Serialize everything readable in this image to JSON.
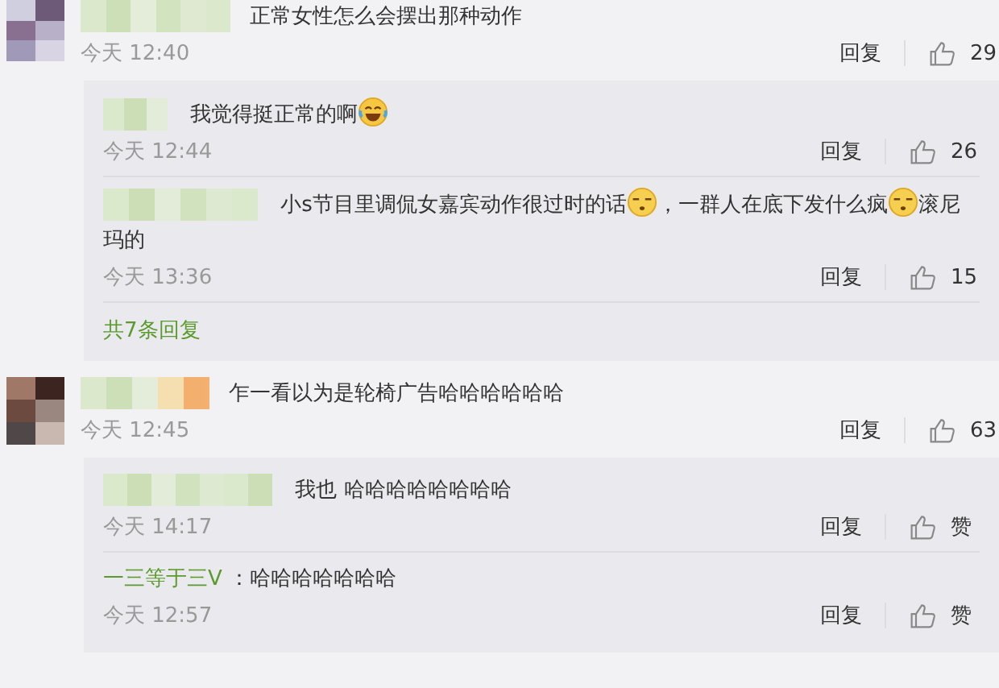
{
  "comments": [
    {
      "avatar": {
        "kind": "mosaic"
      },
      "segments": [
        {
          "kind": "text",
          "text": "正常女性怎么会摆出那种动作"
        }
      ],
      "time": "今天 12:40",
      "reply_label": "回复",
      "likes": "29",
      "replies": [
        {
          "segments": [
            {
              "kind": "text",
              "text": "我觉得挺正常的啊"
            },
            {
              "kind": "laugh"
            }
          ],
          "time": "今天 12:44",
          "reply_label": "回复",
          "likes": "26"
        },
        {
          "segments": [
            {
              "kind": "text",
              "text": "小s节目里调侃女嘉宾动作很过时的话"
            },
            {
              "kind": "squint"
            },
            {
              "kind": "text",
              "text": "，一群人在底下发什么疯"
            },
            {
              "kind": "squint"
            },
            {
              "kind": "text",
              "text": "滚尼"
            },
            {
              "kind": "text",
              "text": "玛的"
            }
          ],
          "time": "今天 13:36",
          "reply_label": "回复",
          "likes": "15"
        }
      ],
      "more_replies": "共7条回复"
    },
    {
      "avatar": {
        "kind": "mosaic"
      },
      "segments": [
        {
          "kind": "text",
          "text": "乍一看以为是轮椅广告哈哈哈哈哈哈"
        }
      ],
      "time": "今天 12:45",
      "reply_label": "回复",
      "likes": "63",
      "replies": [
        {
          "segments": [
            {
              "kind": "text",
              "text": "我也 哈哈哈哈哈哈哈哈"
            }
          ],
          "time": "今天 14:17",
          "reply_label": "回复",
          "likes": "赞"
        },
        {
          "name": "一三等于三V",
          "segments": [
            {
              "kind": "text",
              "text": "：哈哈哈哈哈哈哈"
            }
          ],
          "time": "今天 12:57",
          "reply_label": "回复",
          "likes": "赞"
        }
      ]
    }
  ]
}
